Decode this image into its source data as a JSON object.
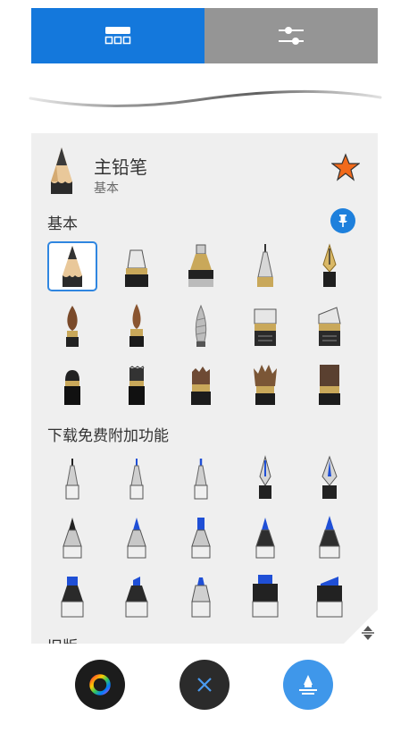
{
  "tabs": [
    {
      "name": "brushes",
      "active": true
    },
    {
      "name": "settings",
      "active": false
    }
  ],
  "current_brush": {
    "name": "主铅笔",
    "category": "基本",
    "favorite": true
  },
  "sections": {
    "basic": "基本",
    "downloads": "下载免费附加功能",
    "legacy": "旧版"
  },
  "colors": {
    "accent_blue": "#1478dc",
    "tab_inactive": "#959595",
    "star_orange": "#f26a1b",
    "ink_blue": "#1f4fd6",
    "panel_bg": "#efefef"
  }
}
